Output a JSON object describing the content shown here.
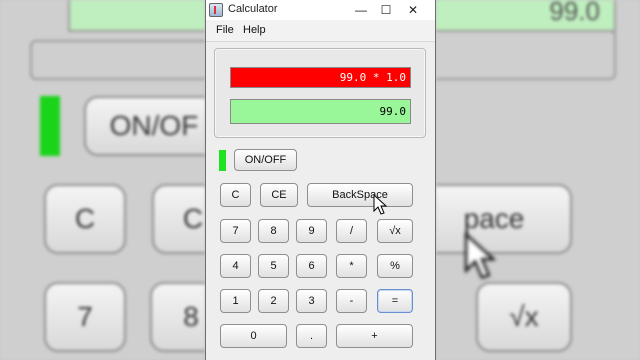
{
  "background": {
    "left": {
      "onoff_label": "ON/OF",
      "c_label": "C",
      "ce_partial": "C",
      "seven_label": "7",
      "eight_label": "8"
    },
    "right": {
      "backspace_partial": "pace",
      "sqrt_label": "√x",
      "top_partial": "99.0"
    }
  },
  "window": {
    "title": "Calculator",
    "controls": {
      "minimize": "—",
      "maximize": "☐",
      "close": "✕"
    }
  },
  "menubar": {
    "items": [
      "File",
      "Help"
    ]
  },
  "display": {
    "expression": "99.0 * 1.0",
    "result": "99.0",
    "expression_bg": "#ff0000",
    "result_bg": "#99f79a"
  },
  "power": {
    "led_color": "#1ee31e",
    "onoff_label": "ON/OFF"
  },
  "keys": {
    "c": "C",
    "ce": "CE",
    "backspace": "BackSpace",
    "seven": "7",
    "eight": "8",
    "nine": "9",
    "divide": "/",
    "sqrt": "√x",
    "four": "4",
    "five": "5",
    "six": "6",
    "multiply": "*",
    "percent": "%",
    "one": "1",
    "two": "2",
    "three": "3",
    "minus": "-",
    "equals": "=",
    "zero": "0",
    "dot": ".",
    "plus": "+"
  }
}
